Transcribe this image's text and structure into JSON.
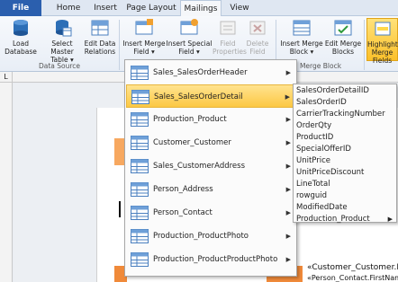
{
  "ribbon_tabs": [
    {
      "label": "File"
    },
    {
      "label": "Home"
    },
    {
      "label": "Insert"
    },
    {
      "label": "Page Layout"
    },
    {
      "label": "Mailings"
    },
    {
      "label": "View"
    }
  ],
  "ribbon_buttons": {
    "load_database": "Load\nDatabase",
    "select_master_table": "Select Master\nTable ▾",
    "edit_data_relations": "Edit Data\nRelations",
    "insert_merge_field": "Insert Merge\nField ▾",
    "insert_special_field": "Insert Special\nField ▾",
    "field_properties": "Field\nProperties",
    "delete_field": "Delete\nField",
    "insert_merge_block": "Insert Merge\nBlock ▾",
    "edit_merge_blocks": "Edit Merge\nBlocks",
    "highlight_merge_fields": "Highlight\nMerge Fields"
  },
  "group_labels": {
    "data_source": "Data Source",
    "merge_block": "Merge Block"
  },
  "ruler_corner": "L",
  "menu_tables": [
    {
      "label": "Sales_SalesOrderHeader"
    },
    {
      "label": "Sales_SalesOrderDetail"
    },
    {
      "label": "Production_Product"
    },
    {
      "label": "Customer_Customer"
    },
    {
      "label": "Sales_CustomerAddress"
    },
    {
      "label": "Person_Address"
    },
    {
      "label": "Person_Contact"
    },
    {
      "label": "Production_ProductPhoto"
    },
    {
      "label": "Production_ProductProductPhoto"
    }
  ],
  "submenu_fields": [
    {
      "label": "SalesOrderDetailID"
    },
    {
      "label": "SalesOrderID"
    },
    {
      "label": "CarrierTrackingNumber"
    },
    {
      "label": "OrderQty"
    },
    {
      "label": "ProductID"
    },
    {
      "label": "SpecialOfferID"
    },
    {
      "label": "UnitPrice"
    },
    {
      "label": "UnitPriceDiscount"
    },
    {
      "label": "LineTotal"
    },
    {
      "label": "rowguid"
    },
    {
      "label": "ModifiedDate"
    },
    {
      "label": "Production_Product"
    }
  ],
  "document": {
    "merge_field_1": "«Customer_Customer.N",
    "merge_field_2": "«Person_Contact.FirstName"
  },
  "colors": {
    "file_tab": "#2b5fae",
    "highlight": "#fbc02a",
    "selected_item": "#fcc843",
    "orange_shape": "#f08a3a"
  }
}
